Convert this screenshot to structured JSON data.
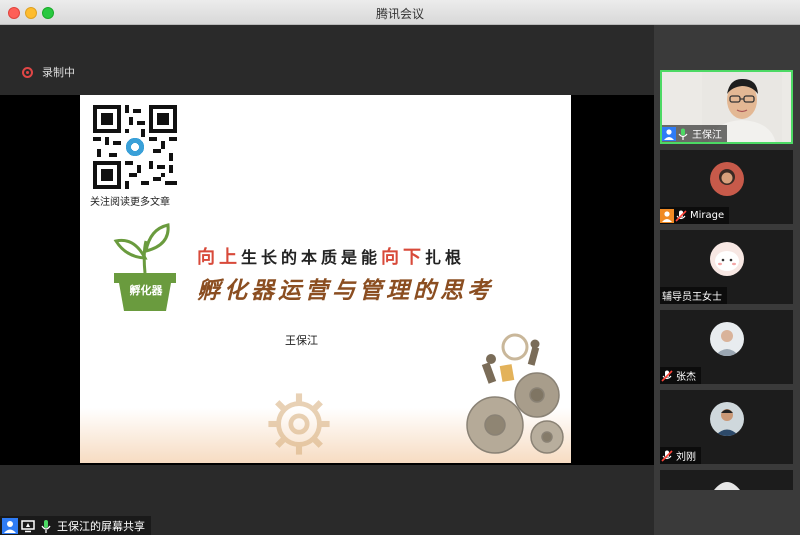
{
  "window": {
    "title": "腾讯会议"
  },
  "recording": {
    "label": "录制中",
    "color": "#e04646"
  },
  "slide": {
    "qr_caption": "关注阅读更多文章",
    "pot_label": "孵化器",
    "tagline": {
      "p1": "向上",
      "p2": "生长的本质是能",
      "p3": "向下",
      "p4": "扎根"
    },
    "title": "孵化器运营与管理的思考",
    "author": "王保江"
  },
  "share": {
    "label": "王保江的屏幕共享"
  },
  "participants": [
    {
      "name": "王保江",
      "active": true
    },
    {
      "name": "Mirage"
    },
    {
      "name": "辅导员王女士"
    },
    {
      "name": "张杰"
    },
    {
      "name": "刘刚"
    }
  ],
  "colors": {
    "active_border": "#4cd964",
    "accent_red": "#d84a3a",
    "title_brown": "#8b4e21"
  }
}
